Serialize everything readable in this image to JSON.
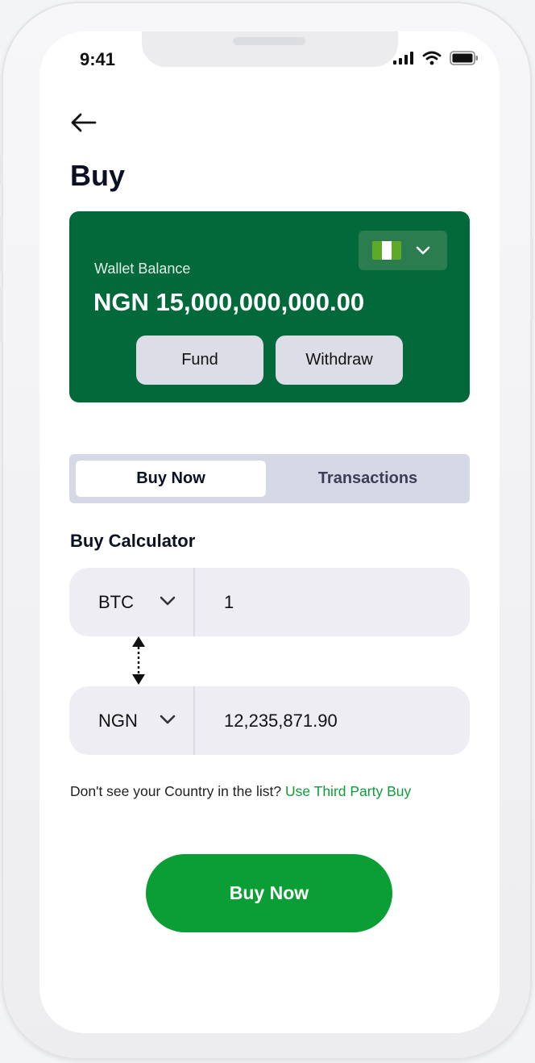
{
  "status_bar": {
    "time": "9:41"
  },
  "page": {
    "title": "Buy"
  },
  "wallet": {
    "label": "Wallet Balance",
    "amount": "NGN 15,000,000,000.00",
    "fund_label": "Fund",
    "withdraw_label": "Withdraw",
    "flag_colors": [
      "#5fa82a",
      "#ffffff",
      "#5fa82a"
    ]
  },
  "tabs": [
    {
      "label": "Buy Now",
      "active": true
    },
    {
      "label": "Transactions",
      "active": false
    }
  ],
  "calculator": {
    "title": "Buy Calculator",
    "from": {
      "currency": "BTC",
      "amount": "1"
    },
    "to": {
      "currency": "NGN",
      "amount": "12,235,871.90"
    }
  },
  "note": {
    "text": "Don't see your Country in the list?",
    "link1": "Use Third Party",
    "link2": "Buy"
  },
  "cta": {
    "label": "Buy Now"
  },
  "colors": {
    "brand": "#02693a",
    "accent": "#0a9e34"
  }
}
